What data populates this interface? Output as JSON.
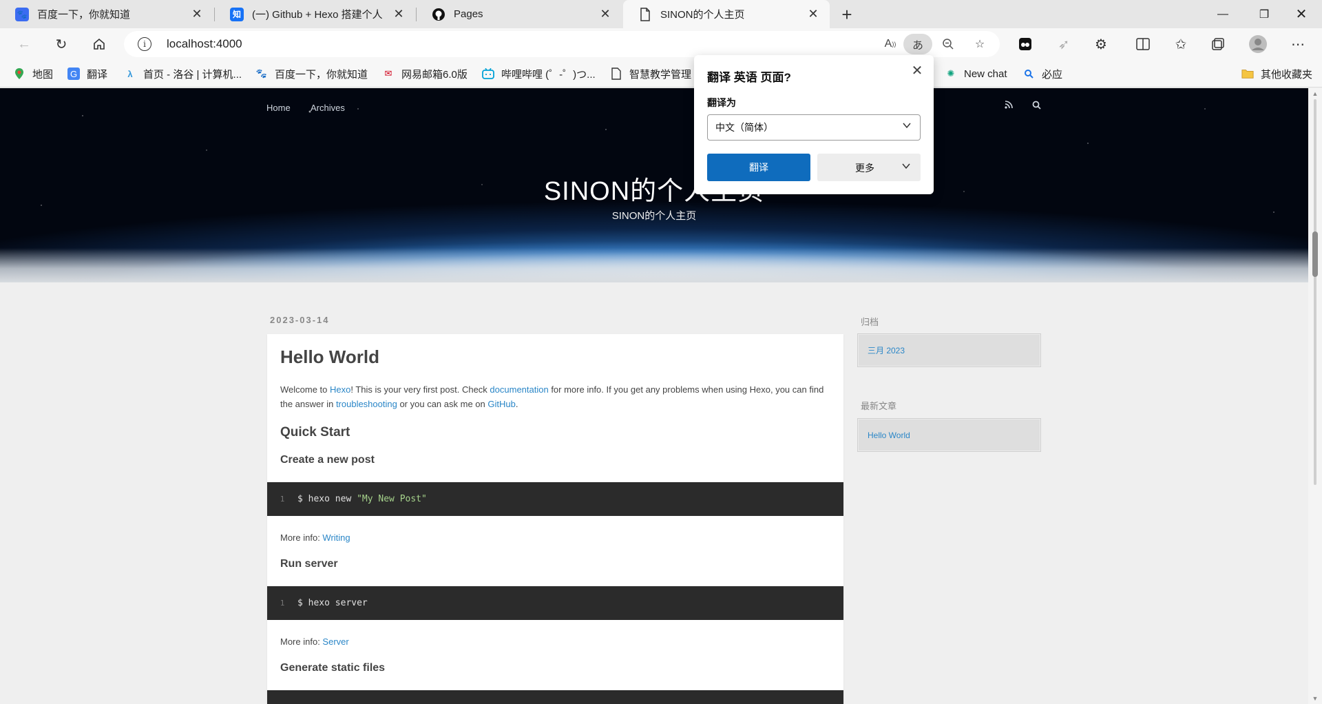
{
  "tabs": [
    {
      "title": "百度一下，你就知道",
      "icon": "baidu-paw-icon",
      "color": "#3b6cf1"
    },
    {
      "title": "(一) Github + Hexo 搭建个人",
      "icon": "zhihu-icon",
      "color": "#1772f6"
    },
    {
      "title": "Pages",
      "icon": "github-icon",
      "color": "#111111"
    },
    {
      "title": "SINON的个人主页",
      "icon": "page-icon",
      "color": "#444444"
    }
  ],
  "address": {
    "url": "localhost:4000",
    "info_glyph": "i"
  },
  "bookmarks": [
    {
      "label": "地图",
      "icon": "map-pin-icon"
    },
    {
      "label": "翻译",
      "icon": "translate-icon"
    },
    {
      "label": "首页 - 洛谷 | 计算机...",
      "icon": "luogu-icon"
    },
    {
      "label": "百度一下，你就知道",
      "icon": "baidu-paw-icon"
    },
    {
      "label": "网易邮箱6.0版",
      "icon": "netease-mail-icon"
    },
    {
      "label": "哔哩哔哩 (゜-゜)つ...",
      "icon": "bilibili-icon"
    },
    {
      "label": "智慧教学管理",
      "icon": "page-icon"
    },
    {
      "label": "New chat",
      "icon": "chatgpt-icon"
    },
    {
      "label": "必应",
      "icon": "bing-search-icon"
    },
    {
      "label": "其他收藏夹",
      "icon": "folder-icon"
    }
  ],
  "site": {
    "nav": [
      "Home",
      "Archives"
    ],
    "title": "SINON的个人主页",
    "subtitle": "SINON的个人主页"
  },
  "post": {
    "date": "2023-03-14",
    "title": "Hello World",
    "intro": {
      "t1": "Welcome to ",
      "l1": "Hexo",
      "t2": "! This is your very first post. Check ",
      "l2": "documentation",
      "t3": " for more info. If you get any problems when using Hexo, you can find the answer in ",
      "l3": "troubleshooting",
      "t4": " or you can ask me on ",
      "l4": "GitHub",
      "t5": "."
    },
    "quick_start": "Quick Start",
    "create_heading": "Create a new post",
    "code1": {
      "ln": "1",
      "cmd": "$ hexo new ",
      "str": "\"My New Post\""
    },
    "more1": {
      "text": "More info: ",
      "link": "Writing"
    },
    "run_heading": "Run server",
    "code2": {
      "ln": "1",
      "cmd": "$ hexo server"
    },
    "more2": {
      "text": "More info: ",
      "link": "Server"
    },
    "generate_heading": "Generate static files"
  },
  "sidebar": {
    "archive_title": "归档",
    "archive_item": "三月 2023",
    "recent_title": "最新文章",
    "recent_item": "Hello World"
  },
  "translate_popup": {
    "title": "翻译 英语 页面?",
    "label": "翻译为",
    "selected_language": "中文（简体）",
    "translate_button": "翻译",
    "more_button": "更多"
  },
  "colors": {
    "accent": "#0f6cbd",
    "link": "#2a86c7",
    "code_bg": "#2b2b2b"
  }
}
